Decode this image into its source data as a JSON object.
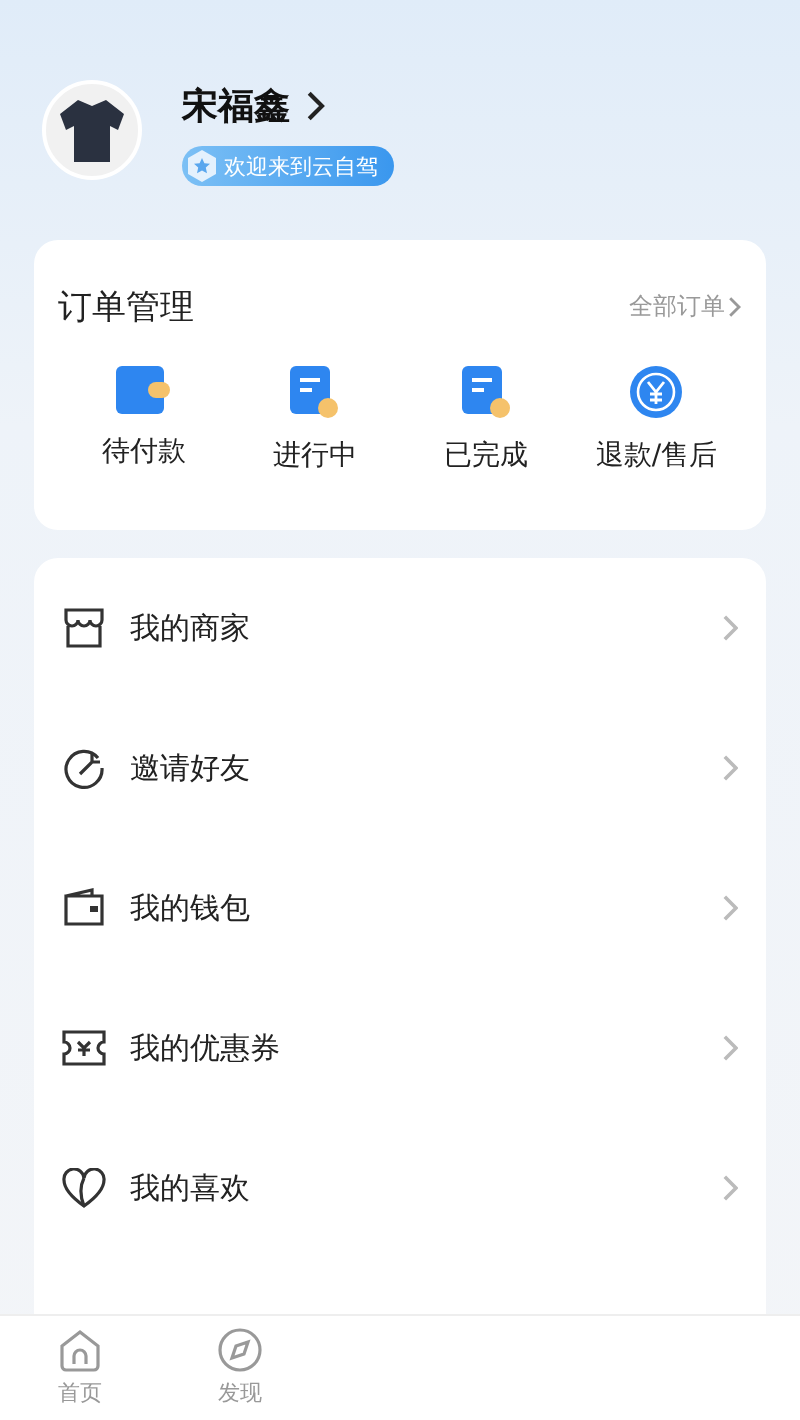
{
  "profile": {
    "name": "宋福鑫",
    "badge": "欢迎来到云自驾"
  },
  "orders": {
    "title": "订单管理",
    "all_link": "全部订单",
    "items": [
      {
        "kind": "wallet",
        "label": "待付款"
      },
      {
        "kind": "doc",
        "label": "进行中"
      },
      {
        "kind": "doc",
        "label": "已完成"
      },
      {
        "kind": "refund",
        "label": "退款/售后"
      }
    ]
  },
  "menu": [
    {
      "kind": "shop",
      "label": "我的商家"
    },
    {
      "kind": "invite",
      "label": "邀请好友"
    },
    {
      "kind": "wallet",
      "label": "我的钱包"
    },
    {
      "kind": "coupon",
      "label": "我的优惠券"
    },
    {
      "kind": "heart",
      "label": "我的喜欢"
    }
  ],
  "tab_bar": [
    {
      "kind": "home",
      "label": "首页",
      "selected": false
    },
    {
      "kind": "compass",
      "label": "发现",
      "selected": false
    }
  ]
}
